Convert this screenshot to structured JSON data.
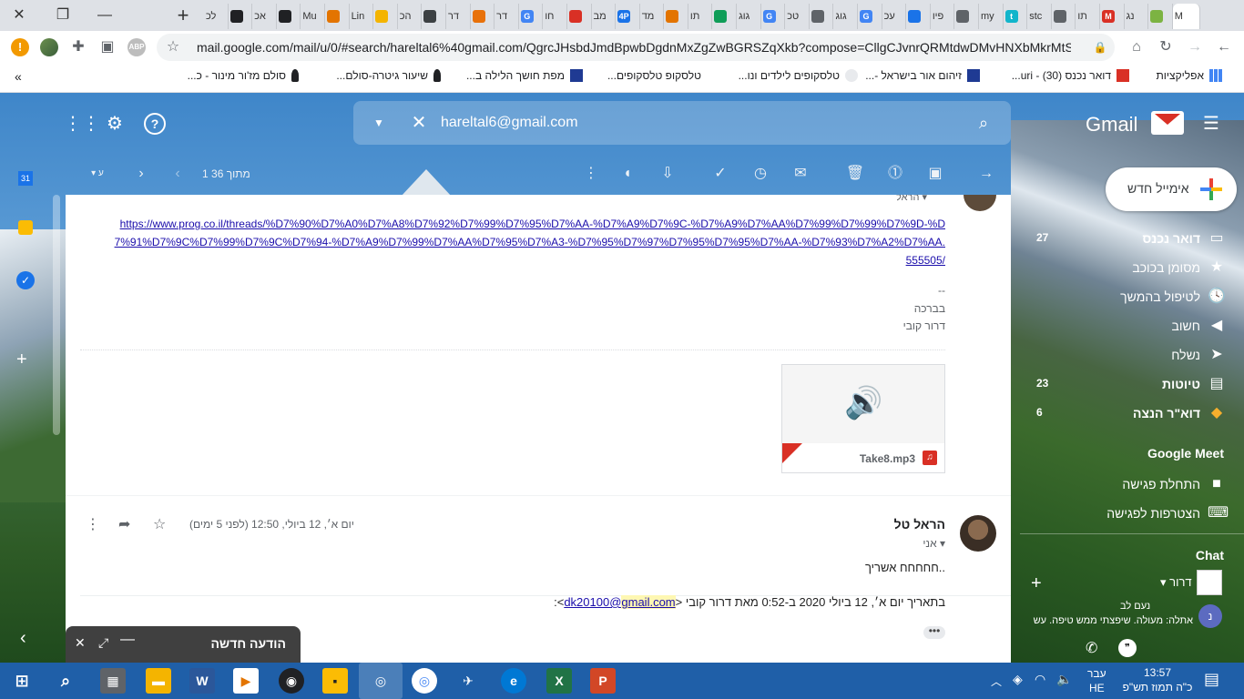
{
  "browser": {
    "tabs": [
      {
        "label": "לכ",
        "color": "#5f6368"
      },
      {
        "label": "",
        "color": "#202124"
      },
      {
        "label": "אכ",
        "color": "#5f6368"
      },
      {
        "label": "",
        "color": "#202124"
      },
      {
        "label": "Mu",
        "color": "#5f6368"
      },
      {
        "label": "",
        "color": "#e37400"
      },
      {
        "label": "Lin",
        "color": "#5f6368"
      },
      {
        "label": "",
        "color": "#f4b400"
      },
      {
        "label": "הכ",
        "color": "#5f6368"
      },
      {
        "label": "",
        "color": "#3c4043"
      },
      {
        "label": "דר",
        "color": "#5f6368"
      },
      {
        "label": "",
        "color": "#e8710a"
      },
      {
        "label": "דר",
        "color": "#5f6368"
      },
      {
        "label": "G",
        "color": "#4285f4"
      },
      {
        "label": "חו",
        "color": "#5f6368"
      },
      {
        "label": "",
        "color": "#d93025"
      },
      {
        "label": "מב",
        "color": "#5f6368"
      },
      {
        "label": "4P",
        "color": "#1a73e8"
      },
      {
        "label": "מד",
        "color": "#5f6368"
      },
      {
        "label": "",
        "color": "#e37400"
      },
      {
        "label": "תו",
        "color": "#5f6368"
      },
      {
        "label": "",
        "color": "#0f9d58"
      },
      {
        "label": "גוג",
        "color": "#5f6368"
      },
      {
        "label": "G",
        "color": "#4285f4"
      },
      {
        "label": "טכ",
        "color": "#5f6368"
      },
      {
        "label": "",
        "color": "#5f6368"
      },
      {
        "label": "גוג",
        "color": "#5f6368"
      },
      {
        "label": "G",
        "color": "#4285f4"
      },
      {
        "label": "עכ",
        "color": "#5f6368"
      },
      {
        "label": "",
        "color": "#1a73e8"
      },
      {
        "label": "פיו",
        "color": "#5f6368"
      },
      {
        "label": "",
        "color": "#5f6368"
      },
      {
        "label": "my",
        "color": "#5f6368"
      },
      {
        "label": "t",
        "color": "#12b5cb"
      },
      {
        "label": "stc",
        "color": "#5f6368"
      },
      {
        "label": "",
        "color": "#5f6368"
      },
      {
        "label": "תו",
        "color": "#5f6368"
      },
      {
        "label": "M",
        "color": "#d93025"
      },
      {
        "label": "נג",
        "color": "#5f6368"
      },
      {
        "label": "",
        "color": "#7cb342"
      },
      {
        "label": "M",
        "color": "#d93025"
      }
    ],
    "new_tab": "+",
    "minimize": "—",
    "restore": "❐",
    "close": "✕",
    "url": "mail.google.com/mail/u/0/#search/hareltal6%40gmail.com/QgrcJHsbdJmdBpwbDgdnMxZgZwBGRSZqXkb?compose=CllgCJvnrQRMtdwDMvHNXbMkrMtSp..."
  },
  "bookmarks": {
    "items": [
      {
        "label": "אפליקציות"
      },
      {
        "label": "דואר נכנס (30) - uri..."
      },
      {
        "label": "זיהום אור בישראל -..."
      },
      {
        "label": "טלסקופים לילדים ונו..."
      },
      {
        "label": "טלסקופ טלסקופים..."
      },
      {
        "label": "מפת חושך הלילה ב..."
      },
      {
        "label": "שיעור גיטרה-סולם..."
      },
      {
        "label": "סולם מז'ור מינור - כ..."
      }
    ],
    "more": "»"
  },
  "gmail": {
    "logo": "Gmail",
    "search_value": "hareltal6@gmail.com",
    "pagination": "1 מתוך 36",
    "compose_label": "אימייל חדש",
    "nav": [
      {
        "label": "דואר נכנס",
        "count": "27",
        "bold": true,
        "icon": "▭"
      },
      {
        "label": "מסומן בכוכב",
        "count": "",
        "bold": false,
        "icon": "★"
      },
      {
        "label": "לטיפול בהמשך",
        "count": "",
        "bold": false,
        "icon": "🕓"
      },
      {
        "label": "חשוב",
        "count": "",
        "bold": false,
        "icon": "◀"
      },
      {
        "label": "נשלח",
        "count": "",
        "bold": false,
        "icon": "➤"
      },
      {
        "label": "טיוטות",
        "count": "23",
        "bold": true,
        "icon": "▤"
      },
      {
        "label": "דוא\"ר הנצה",
        "count": "6",
        "bold": true,
        "icon": "◆"
      }
    ],
    "meet_title": "Google Meet",
    "meet_items": [
      {
        "label": "התחלת פגישה"
      },
      {
        "label": "הצטרפות לפגישה"
      }
    ],
    "chat_title": "Chat",
    "chat_user": "דרור",
    "chat_preview_name": "נעם לב",
    "chat_preview_text": "אתלה: מעולה. שיפצתי ממש טיפה. עשית"
  },
  "message1": {
    "from_hint": "הראל",
    "link": "https://www.prog.co.il/threads/%D7%90%D7%A0%D7%A8%D7%92%D7%99%D7%95%D7%AA-%D7%A9%D7%9C-%D7%A9%D7%AA%D7%99%D7%99%D7%9D-%D7%91%D7%9C%D7%99%D7%9C%D7%94-%D7%A9%D7%99%D7%AA%D7%95%D7%A3-%D7%95%D7%97%D7%95%D7%95%D7%AA-%D7%93%D7%A2%D7%AA.555505/",
    "sig_dash": "--",
    "sig_line1": "בברכה",
    "sig_line2": "דרור קובי",
    "attachment": "Take8.mp3"
  },
  "message2": {
    "sender": "הראל טל",
    "to": "אני",
    "date": "יום א׳, 12 ביולי, 12:50 (לפני 5 ימים)",
    "body": "חחחחח אשריך..",
    "quote_prefix": "בתאריך יום א׳, 12 ביולי 2020 ב-0:52 מאת דרור קובי <",
    "quote_email_user": "dk20100@",
    "quote_email_domain": "gmail.com",
    "quote_suffix": ">:"
  },
  "compose_min": {
    "title": "הודעה חדשה"
  },
  "taskbar": {
    "lang_top": "עבר",
    "lang_bottom": "HE",
    "time": "13:57",
    "date": "כ\"ה תמוז תש\"פ"
  }
}
